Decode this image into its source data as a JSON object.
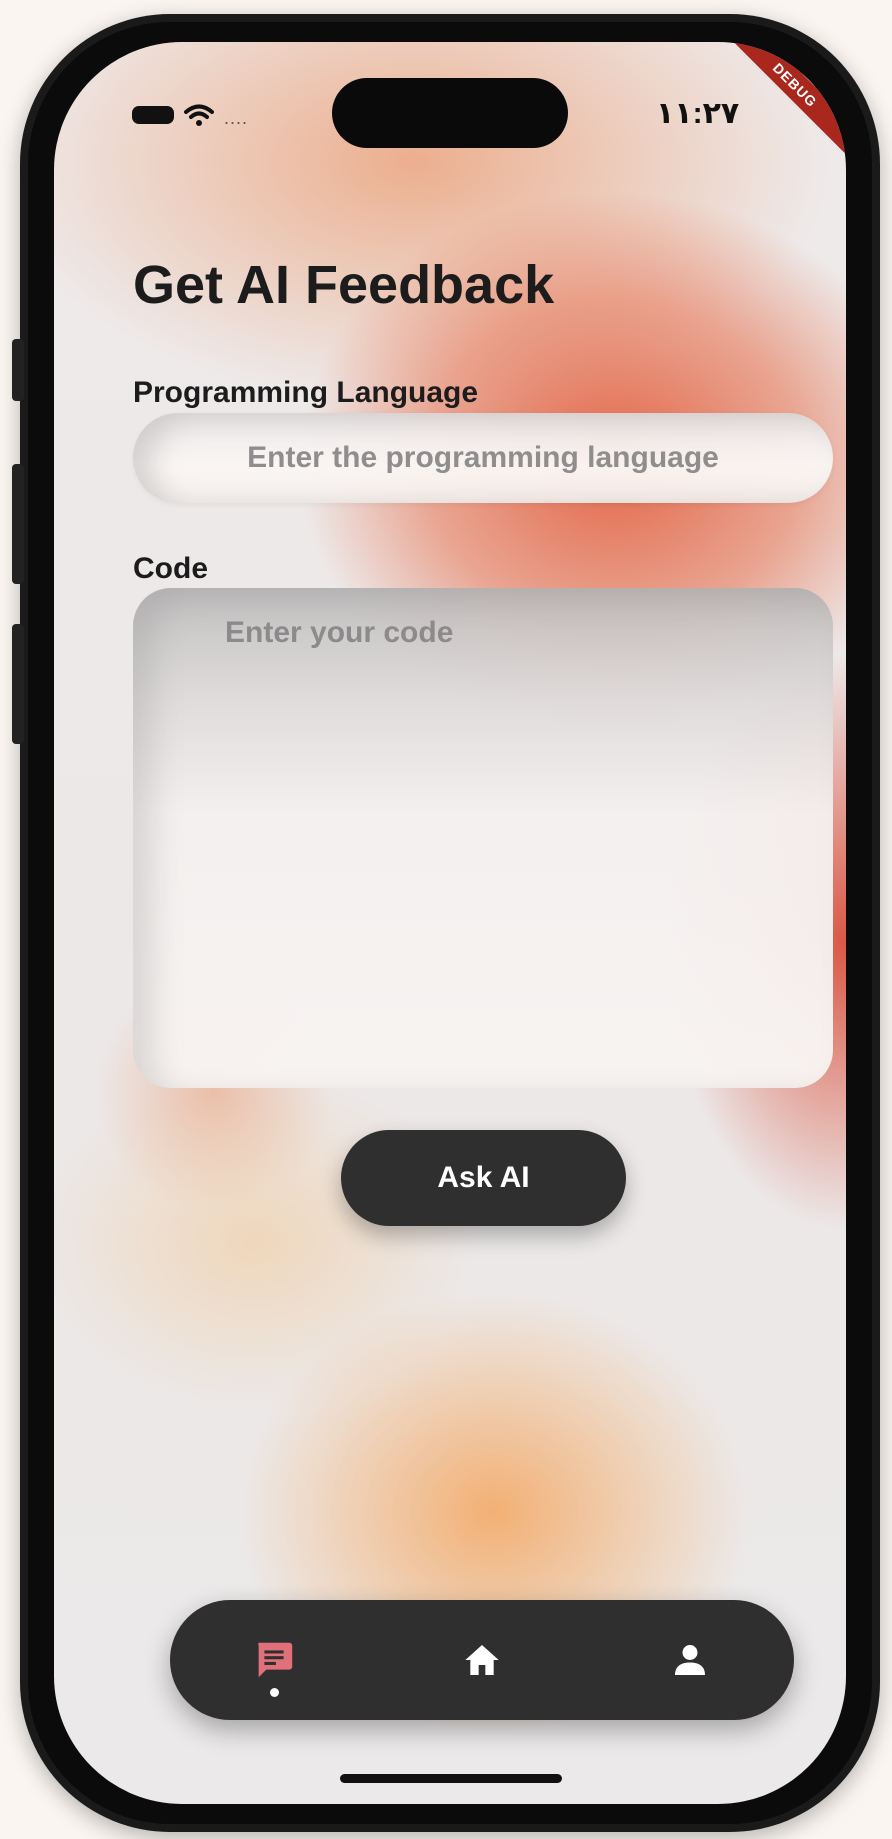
{
  "status_bar": {
    "signal_dots": "....",
    "time": "١١:٢٧",
    "debug_label": "DEBUG"
  },
  "page": {
    "title": "Get AI Feedback"
  },
  "form": {
    "language_label": "Programming Language",
    "language_placeholder": "Enter the programming language",
    "language_value": "",
    "code_label": "Code",
    "code_placeholder": "Enter your code",
    "code_value": "",
    "submit_label": "Ask AI"
  },
  "bottom_nav": {
    "items": [
      {
        "icon": "chat-icon",
        "active": true,
        "color": "#e0707a"
      },
      {
        "icon": "home-icon",
        "active": false,
        "color": "#ffffff"
      },
      {
        "icon": "person-icon",
        "active": false,
        "color": "#ffffff"
      }
    ]
  },
  "colors": {
    "accent_active": "#e0707a",
    "button_dark": "#2f2f2f",
    "debug_ribbon": "#a9271d"
  }
}
